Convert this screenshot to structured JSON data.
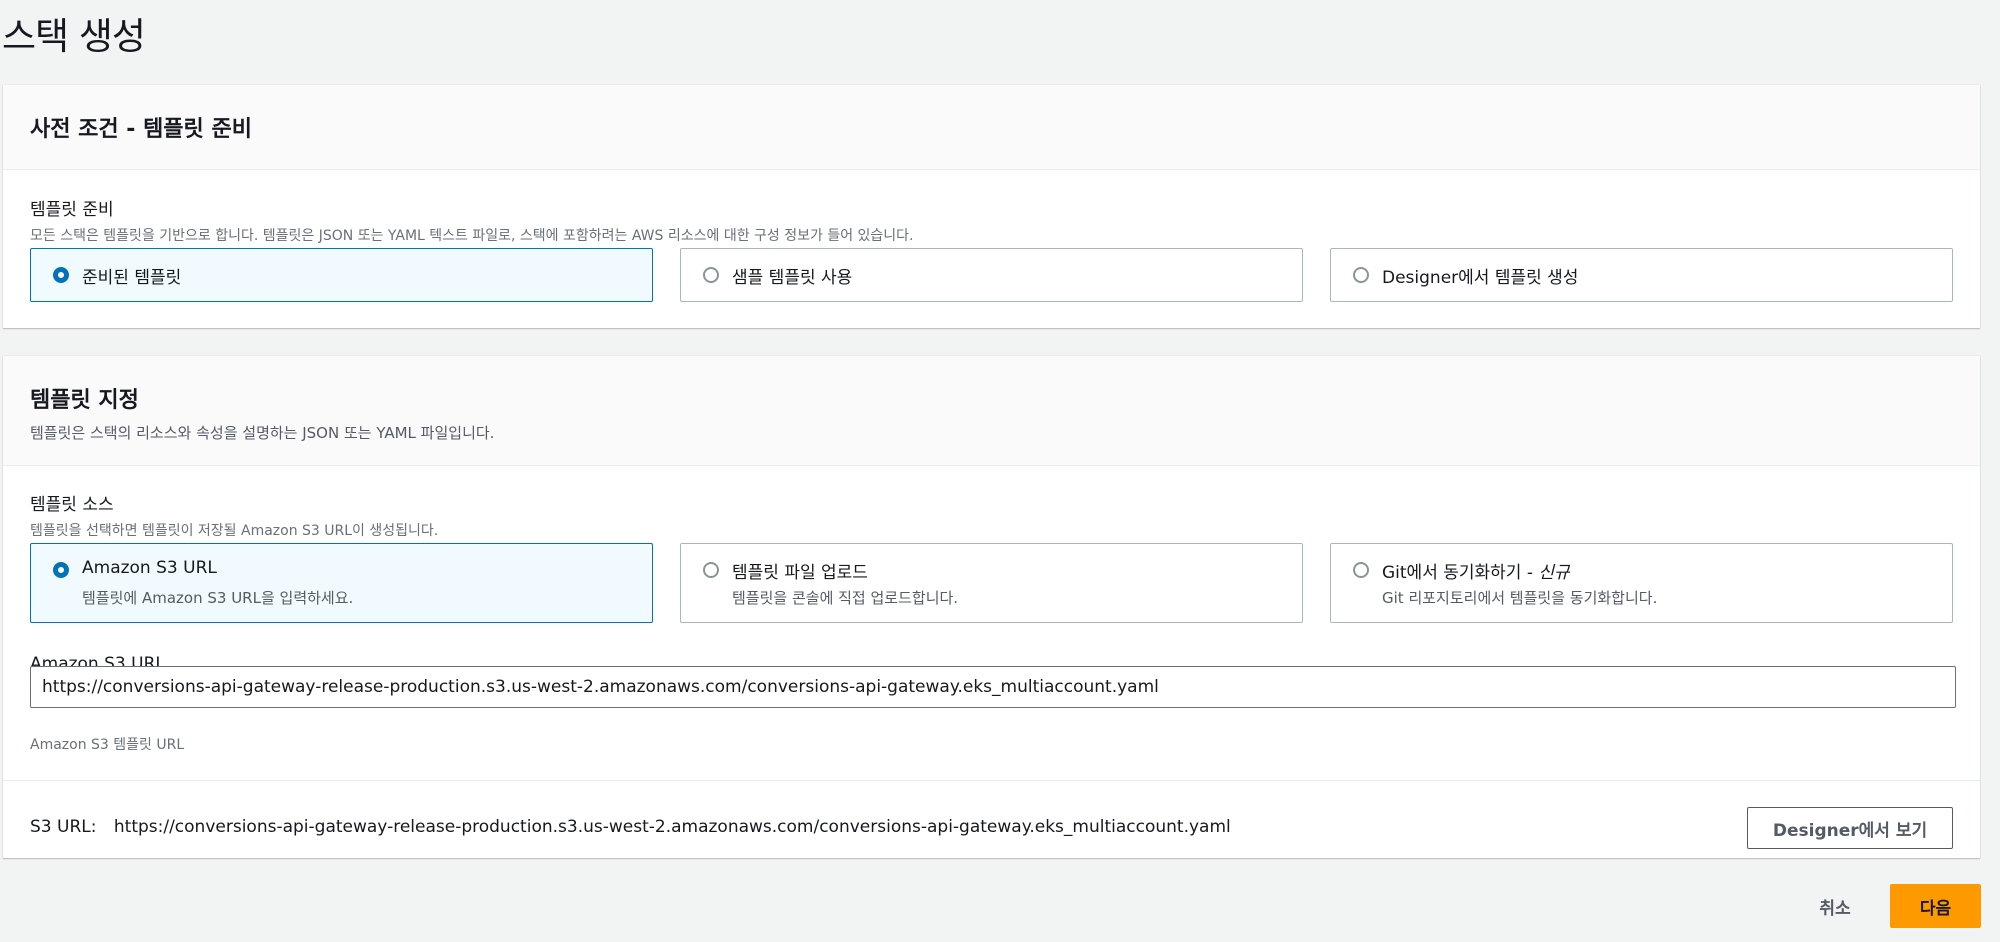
{
  "page": {
    "title": "스택 생성"
  },
  "prerequisite": {
    "title": "사전 조건 - 템플릿 준비",
    "field_label": "템플릿 준비",
    "field_desc": "모든 스택은 템플릿을 기반으로 합니다. 템플릿은 JSON 또는 YAML 텍스트 파일로, 스택에 포함하려는 AWS 리소스에 대한 구성 정보가 들어 있습니다.",
    "options": [
      {
        "label": "준비된 템플릿",
        "selected": true
      },
      {
        "label": "샘플 템플릿 사용",
        "selected": false
      },
      {
        "label": "Designer에서 템플릿 생성",
        "selected": false
      }
    ]
  },
  "specify": {
    "title": "템플릿 지정",
    "desc": "템플릿은 스택의 리소스와 속성을 설명하는 JSON 또는 YAML 파일입니다.",
    "source_label": "템플릿 소스",
    "source_desc": "템플릿을 선택하면 템플릿이 저장될 Amazon S3 URL이 생성됩니다.",
    "sources": [
      {
        "label": "Amazon S3 URL",
        "desc": "템플릿에 Amazon S3 URL을 입력하세요.",
        "selected": true
      },
      {
        "label": "템플릿 파일 업로드",
        "desc": "템플릿을 콘솔에 직접 업로드합니다.",
        "selected": false
      },
      {
        "label": "Git에서 동기화하기 - ",
        "badge": "신규",
        "desc": "Git 리포지토리에서 템플릿을 동기화합니다.",
        "selected": false
      }
    ],
    "url_label": "Amazon S3 URL",
    "url_value": "https://conversions-api-gateway-release-production.s3.us-west-2.amazonaws.com/conversions-api-gateway.eks_multiaccount.yaml",
    "url_hint": "Amazon S3 템플릿 URL",
    "s3_url_label": "S3 URL:",
    "s3_url_value": "https://conversions-api-gateway-release-production.s3.us-west-2.amazonaws.com/conversions-api-gateway.eks_multiaccount.yaml",
    "designer_button": "Designer에서 보기"
  },
  "footer": {
    "cancel": "취소",
    "next": "다음"
  },
  "colors": {
    "primary": "#ff9900",
    "selected_border": "#0073bb",
    "selected_bg": "#f1faff",
    "page_bg": "#f2f3f3"
  }
}
